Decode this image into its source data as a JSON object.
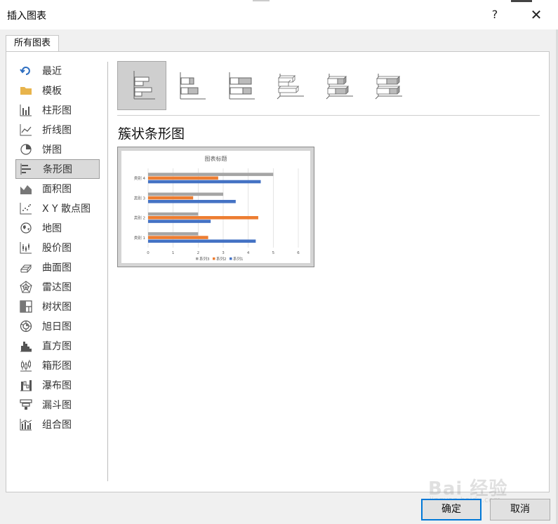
{
  "window": {
    "title": "插入图表",
    "help_label": "?",
    "close_label": "✕"
  },
  "tab": {
    "label": "所有图表"
  },
  "sidebar": {
    "items": [
      {
        "label": "最近",
        "icon": "undo-icon"
      },
      {
        "label": "模板",
        "icon": "folder-icon"
      },
      {
        "label": "柱形图",
        "icon": "column-chart-icon"
      },
      {
        "label": "折线图",
        "icon": "line-chart-icon"
      },
      {
        "label": "饼图",
        "icon": "pie-chart-icon"
      },
      {
        "label": "条形图",
        "icon": "bar-chart-icon",
        "selected": true
      },
      {
        "label": "面积图",
        "icon": "area-chart-icon"
      },
      {
        "label": "X Y 散点图",
        "icon": "scatter-chart-icon"
      },
      {
        "label": "地图",
        "icon": "globe-icon"
      },
      {
        "label": "股价图",
        "icon": "stock-chart-icon"
      },
      {
        "label": "曲面图",
        "icon": "surface-chart-icon"
      },
      {
        "label": "雷达图",
        "icon": "radar-chart-icon"
      },
      {
        "label": "树状图",
        "icon": "treemap-icon"
      },
      {
        "label": "旭日图",
        "icon": "sunburst-icon"
      },
      {
        "label": "直方图",
        "icon": "histogram-icon"
      },
      {
        "label": "箱形图",
        "icon": "box-whisker-icon"
      },
      {
        "label": "瀑布图",
        "icon": "waterfall-icon"
      },
      {
        "label": "漏斗图",
        "icon": "funnel-icon"
      },
      {
        "label": "组合图",
        "icon": "combo-chart-icon"
      }
    ]
  },
  "subtypes": [
    {
      "icon": "clustered-bar-icon",
      "selected": true
    },
    {
      "icon": "stacked-bar-icon"
    },
    {
      "icon": "percent-stacked-bar-icon"
    },
    {
      "icon": "clustered-bar-3d-icon"
    },
    {
      "icon": "stacked-bar-3d-icon"
    },
    {
      "icon": "percent-stacked-bar-3d-icon"
    }
  ],
  "chart_name": "簇状条形图",
  "colors": {
    "series1": "#4472c4",
    "series2": "#ed7d31",
    "series3": "#a5a5a5",
    "accent": "#0078d7"
  },
  "chart_data": {
    "type": "bar",
    "orientation": "horizontal",
    "title": "图表标题",
    "categories": [
      "类别 1",
      "类别 2",
      "类别 3",
      "类别 4"
    ],
    "series": [
      {
        "name": "系列1",
        "values": [
          4.3,
          2.5,
          3.5,
          4.5
        ]
      },
      {
        "name": "系列2",
        "values": [
          2.4,
          4.4,
          1.8,
          2.8
        ]
      },
      {
        "name": "系列3",
        "values": [
          2,
          2,
          3,
          5
        ]
      }
    ],
    "xlim": [
      0,
      6
    ],
    "xticks": [
      "0",
      "1",
      "2",
      "3",
      "4",
      "5",
      "6"
    ],
    "grid": true,
    "legend_position": "bottom"
  },
  "buttons": {
    "ok": "确定",
    "cancel": "取消"
  },
  "watermark": {
    "text": "Bai 经验",
    "url": "jingyan.baidu.com"
  }
}
